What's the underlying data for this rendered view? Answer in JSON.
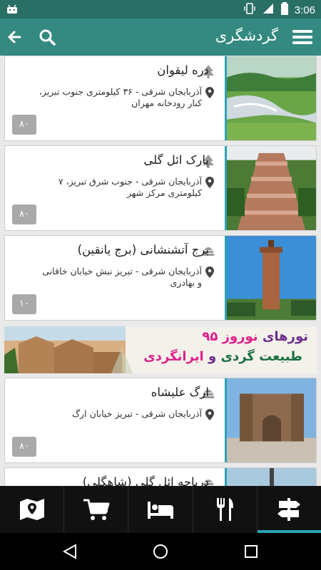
{
  "status_bar": {
    "time": "3:06",
    "icons": [
      "android-icon",
      "vibrate-icon",
      "signal-icon",
      "battery-icon"
    ]
  },
  "app_bar": {
    "title": "گردشگری",
    "icons": [
      "menu-icon",
      "search-icon",
      "back-arrow-icon"
    ]
  },
  "places": [
    {
      "name": "دره لیقوان",
      "category_icon": "tree-icon",
      "address": "آذربایجان شرقی - ۳۶ کیلومتری جنوب تبریز، کنار رودخانه مهران",
      "badge": "۸۰",
      "photo": "river-valley"
    },
    {
      "name": "پارک ائل گلی",
      "category_icon": "tree-icon",
      "address": "آذربایجان شرقی - جنوب شرق تبریز، ۷ کیلومتری مرکز شهر",
      "badge": "۸۰",
      "photo": "park-stairs"
    },
    {
      "name": "برج آتشنشانی (برج یانقین)",
      "category_icon": "monument-icon",
      "address": "آذربایجان شرقی - تبریز نبش خیابان خاقانی و بهادری",
      "badge": "۱۰",
      "photo": "tower"
    },
    {
      "name": "ارگ علیشاه",
      "category_icon": "monument-icon",
      "address": "آذربایجان شرقی - تبریز خیابان ارگ",
      "badge": "۸۰",
      "photo": "citadel"
    },
    {
      "name": "دریاچه ائل گلی (شاهگلی)",
      "category_icon": "monument-icon",
      "address": "",
      "badge": "",
      "photo": "lake"
    }
  ],
  "banner": {
    "line1_prefix": "تورهای",
    "line1_highlight": "نوروز ۹۵",
    "line2_prefix": "طبیعت گردی",
    "line2_mid": "و",
    "line2_highlight": "ایرانگردی"
  },
  "bottom_nav": {
    "items": [
      "map-icon",
      "cart-icon",
      "bed-icon",
      "restaurant-icon",
      "signpost-icon"
    ],
    "active_index": 4
  },
  "system_nav": [
    "back-icon",
    "home-icon",
    "recents-icon"
  ],
  "colors": {
    "app_bar": "#348a80",
    "status_bar": "#2a6f66",
    "accent": "#2aa3b5",
    "badge": "#a9a9a9"
  }
}
